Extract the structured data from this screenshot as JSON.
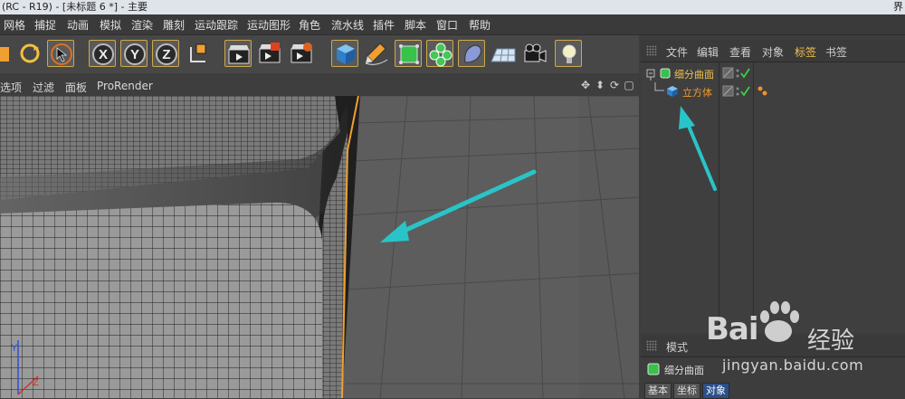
{
  "window": {
    "title": "(RC - R19) - [未标题 6 *] - 主要",
    "right_label": "界"
  },
  "menu": {
    "items": [
      "网格",
      "捕捉",
      "动画",
      "模拟",
      "渲染",
      "雕刻",
      "运动跟踪",
      "运动图形",
      "角色",
      "流水线",
      "插件",
      "脚本",
      "窗口",
      "帮助"
    ]
  },
  "viewport_menu": {
    "items": [
      "选项",
      "过滤",
      "面板",
      "ProRender"
    ]
  },
  "object_manager": {
    "tabs": [
      "文件",
      "编辑",
      "查看",
      "对象",
      "标签",
      "书签"
    ],
    "active_tab": "标签",
    "objects": [
      {
        "name": "细分曲面",
        "color": "#f0c050",
        "icon": "subdivision-surface-icon"
      },
      {
        "name": "立方体",
        "color": "#f09a2a",
        "icon": "cube-icon"
      }
    ]
  },
  "attributes": {
    "tabs": [
      "模式"
    ],
    "selected_object": "细分曲面",
    "sub_tabs": [
      "基本",
      "坐标",
      "对象"
    ],
    "active_sub_tab": "对象"
  },
  "watermark": {
    "brand": "Bai",
    "brand2": "经验",
    "url": "jingyan.baidu.com"
  },
  "colors": {
    "accent_orange": "#f0a030",
    "arrow_cyan": "#29c4c8",
    "selected_blue": "#2c4f86"
  }
}
